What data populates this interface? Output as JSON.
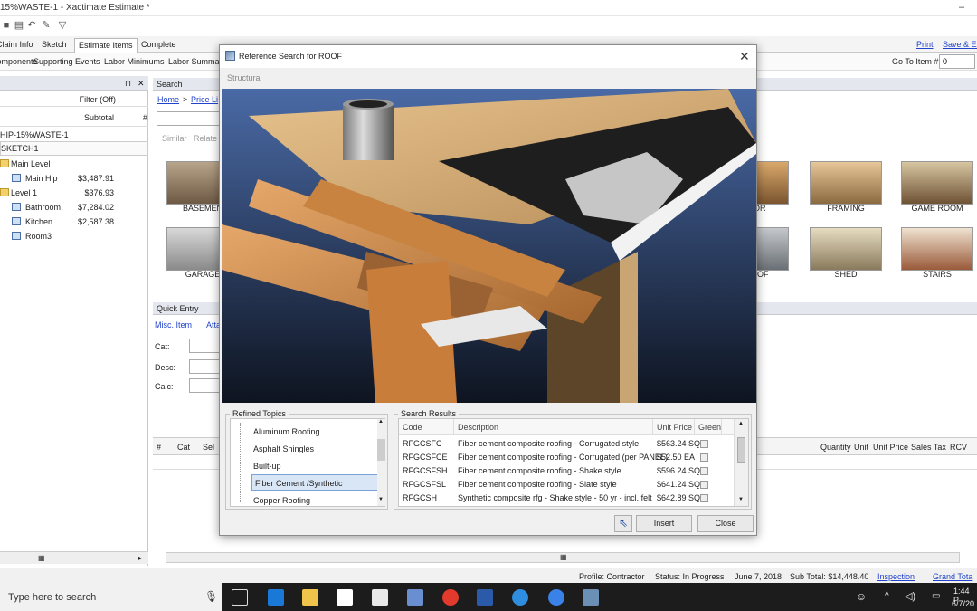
{
  "window": {
    "title": "15%WASTE-1 - Xactimate Estimate *",
    "minimize": "–"
  },
  "tabs": [
    {
      "label": "Claim Info"
    },
    {
      "label": "Sketch"
    },
    {
      "label": "Estimate Items"
    },
    {
      "label": "Complete"
    }
  ],
  "top_links": {
    "print": "Print",
    "save": "Save & Ex"
  },
  "subtoolbar": {
    "items": [
      "Components",
      "Supporting Events",
      "Labor Minimums",
      "Labor Summar"
    ],
    "goto_label": "Go To Item #:",
    "goto_value": "0"
  },
  "left_panel": {
    "pin": "⊓",
    "close": "✕",
    "filter": "Filter (Off)",
    "subtotal": "Subtotal",
    "hash": "#",
    "project": "HIP-15%WASTE-1",
    "sketch": "SKETCH1",
    "rows": [
      {
        "label": "Main Level",
        "amount": "",
        "type": "folder"
      },
      {
        "label": "Main Hip",
        "amount": "$3,487.91",
        "type": "room"
      },
      {
        "label": "Level 1",
        "amount": "$376.93",
        "type": "folder"
      },
      {
        "label": "Bathroom",
        "amount": "$7,284.02",
        "type": "room"
      },
      {
        "label": "Kitchen",
        "amount": "$2,587.38",
        "type": "room"
      },
      {
        "label": "Room3",
        "amount": "",
        "type": "room"
      }
    ]
  },
  "search_panel": {
    "header": "Search",
    "home": "Home",
    "price_list": "Price Li",
    "similar": "Similar",
    "related": "Relate",
    "tiles_left": [
      "BASEMEN",
      "GARAGE"
    ],
    "tiles_right": [
      "OR",
      "FRAMING",
      "GAME ROOM",
      "OF",
      "SHED",
      "STAIRS"
    ]
  },
  "quick_entry": {
    "header": "Quick Entry",
    "misc": "Misc. Item",
    "attach": "Atta",
    "cat": "Cat:",
    "desc": "Desc:",
    "calc": "Calc:"
  },
  "grid_columns_left": [
    "#",
    "Cat",
    "Sel"
  ],
  "grid_columns_right": [
    "Quantity",
    "Unit",
    "Unit Price",
    "Sales Tax",
    "RCV"
  ],
  "dialog": {
    "title": "Reference Search for ROOF",
    "close": "✕",
    "breadcrumb": "Structural",
    "refined_label": "Refined Topics",
    "topics": [
      "Aluminum Roofing",
      "Asphalt Shingles",
      "Built-up",
      "Fiber Cement /Synthetic",
      "Copper Roofing"
    ],
    "results_label": "Search Results",
    "columns": [
      "Code",
      "Description",
      "Unit Price",
      "Green"
    ],
    "results": [
      {
        "code": "RFGCSFC",
        "desc": "Fiber cement composite roofing - Corrugated style",
        "price": "$563.24 SQ"
      },
      {
        "code": "RFGCSFCE",
        "desc": "Fiber cement composite roofing - Corrugated (per PANEL)",
        "price": "$52.50 EA"
      },
      {
        "code": "RFGCSFSH",
        "desc": "Fiber cement composite roofing - Shake style",
        "price": "$596.24 SQ"
      },
      {
        "code": "RFGCSFSL",
        "desc": "Fiber cement composite roofing - Slate style",
        "price": "$641.24 SQ"
      },
      {
        "code": "RFGCSH",
        "desc": "Synthetic composite rfg - Shake style - 50 yr - incl. felt",
        "price": "$642.89 SQ"
      }
    ],
    "insert": "Insert",
    "close_btn": "Close"
  },
  "status": {
    "profile": "Profile: Contractor",
    "status": "Status: In Progress",
    "date": "June 7, 2018",
    "subtotal": "Sub Total: $14,448.40",
    "inspection": "Inspection",
    "grand_total": "Grand Tota"
  },
  "taskbar": {
    "search_placeholder": "Type here to search",
    "time": "1:44 P",
    "date": "6/7/20"
  }
}
